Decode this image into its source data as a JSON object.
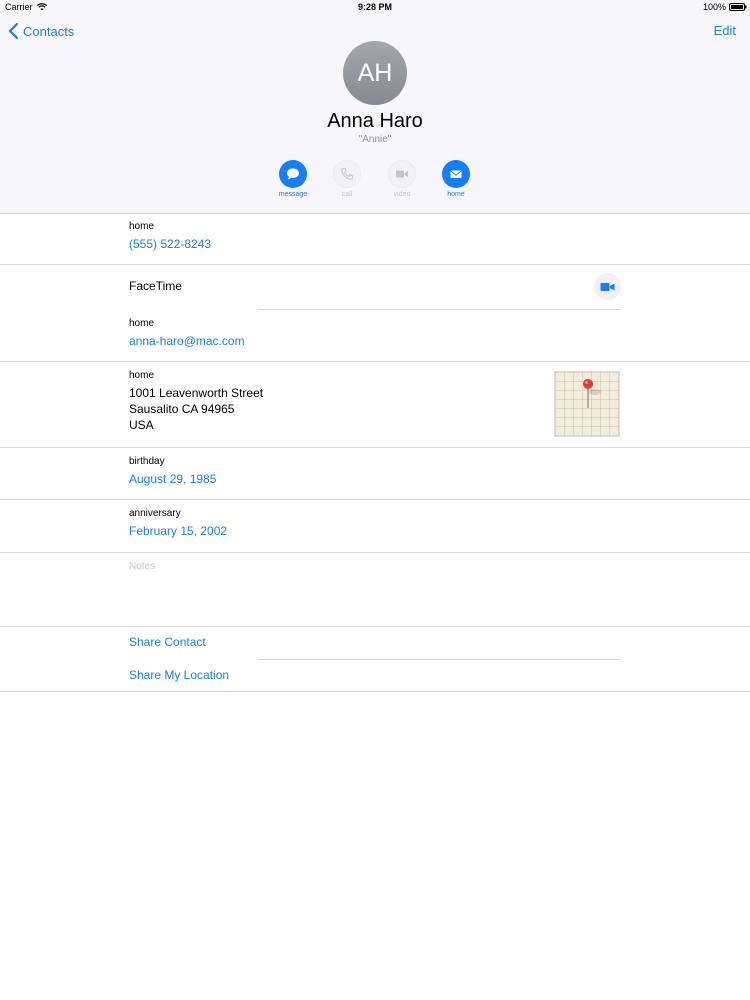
{
  "status_bar": {
    "carrier": "Carrier",
    "time": "9:28 PM",
    "battery": "100%"
  },
  "nav": {
    "back_label": "Contacts",
    "edit_label": "Edit"
  },
  "contact": {
    "initials": "AH",
    "name": "Anna Haro",
    "nickname": "\"Annie\""
  },
  "actions": [
    {
      "label": "message",
      "icon": "message-bubble-icon",
      "enabled": true
    },
    {
      "label": "call",
      "icon": "phone-icon",
      "enabled": false
    },
    {
      "label": "video",
      "icon": "video-camera-icon",
      "enabled": false
    },
    {
      "label": "home",
      "icon": "mail-envelope-icon",
      "enabled": true
    }
  ],
  "phone": {
    "label": "home",
    "value": "(555) 522-8243"
  },
  "facetime": {
    "label": "FaceTime"
  },
  "email": {
    "label": "home",
    "value": "anna-haro@mac.com"
  },
  "address": {
    "label": "home",
    "lines": [
      "1001  Leavenworth Street",
      "Sausalito CA 94965",
      "USA"
    ]
  },
  "birthday": {
    "label": "birthday",
    "value": "August 29, 1985"
  },
  "anniversary": {
    "label": "anniversary",
    "value": "February 15, 2002"
  },
  "notes": {
    "placeholder": "Notes"
  },
  "links": {
    "share_contact": "Share Contact",
    "share_location": "Share My Location"
  },
  "colors": {
    "accent": "#147efb",
    "header_bg": "#f7f7fb",
    "separator": "#d6d6da",
    "avatar": "#9a9ca3"
  }
}
